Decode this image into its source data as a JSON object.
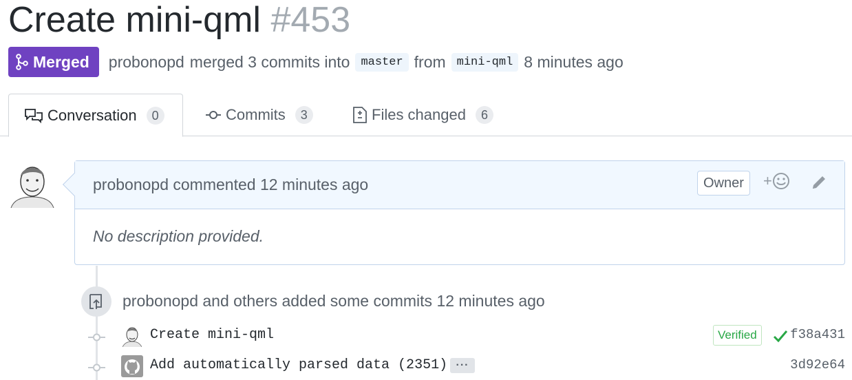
{
  "pr": {
    "title": "Create mini-qml",
    "number": "#453",
    "state_label": "Merged",
    "state_color": "#6f42c1",
    "author": "probonopd",
    "merge_text": "merged 3 commits into",
    "base_branch": "master",
    "from_text": "from",
    "head_branch": "mini-qml",
    "time": "8 minutes ago"
  },
  "tabs": [
    {
      "label": "Conversation",
      "count": "0",
      "icon": "comment-discussion-icon",
      "active": true
    },
    {
      "label": "Commits",
      "count": "3",
      "icon": "git-commit-icon",
      "active": false
    },
    {
      "label": "Files changed",
      "count": "6",
      "icon": "file-diff-icon",
      "active": false
    }
  ],
  "comment": {
    "author": "probonopd",
    "action": "commented",
    "time": "12 minutes ago",
    "role_badge": "Owner",
    "reaction_label": "+",
    "body": "No description provided."
  },
  "timeline": {
    "push_text": "probonopd and others added some commits 12 minutes ago",
    "commits": [
      {
        "message": "Create mini-qml",
        "verified": "Verified",
        "sha": "f38a431",
        "avatar": "user-avatar"
      },
      {
        "message": "Add automatically parsed data (2351)",
        "ellipsis": "···",
        "sha": "3d92e64",
        "avatar": "github-avatar"
      }
    ]
  }
}
